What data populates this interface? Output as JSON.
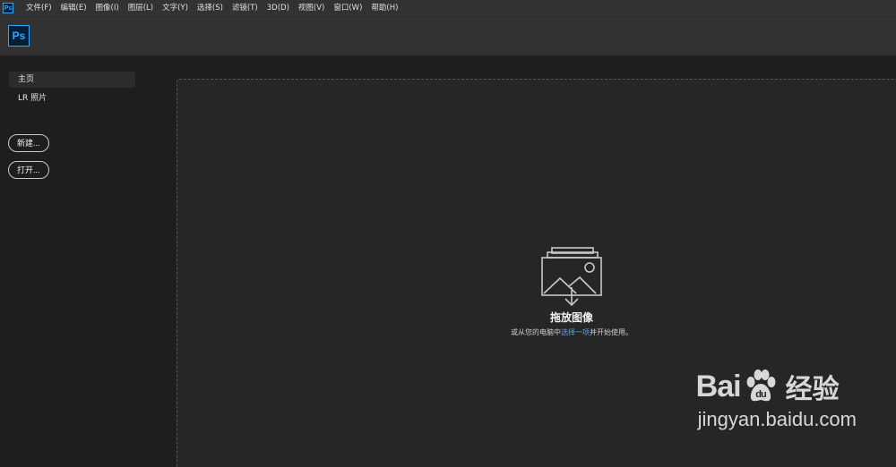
{
  "menubar": {
    "items": [
      "文件(F)",
      "编辑(E)",
      "图像(I)",
      "图层(L)",
      "文字(Y)",
      "选择(S)",
      "滤镜(T)",
      "3D(D)",
      "视图(V)",
      "窗口(W)",
      "帮助(H)"
    ]
  },
  "app": {
    "logo_text": "Ps",
    "accent": "#31a8ff"
  },
  "sidebar": {
    "items": [
      {
        "label": "主页",
        "active": true
      },
      {
        "label": "LR 照片",
        "active": false
      }
    ],
    "new_button": "新建...",
    "open_button": "打开..."
  },
  "dropzone": {
    "icon": "image-drop-icon",
    "title": "拖放图像",
    "subtitle_before": "或从您的电脑中",
    "subtitle_link": "选择一项",
    "subtitle_after": "并开始使用。"
  },
  "watermark": {
    "brand_left": "Bai",
    "brand_right": "经验",
    "url": "jingyan.baidu.com"
  }
}
